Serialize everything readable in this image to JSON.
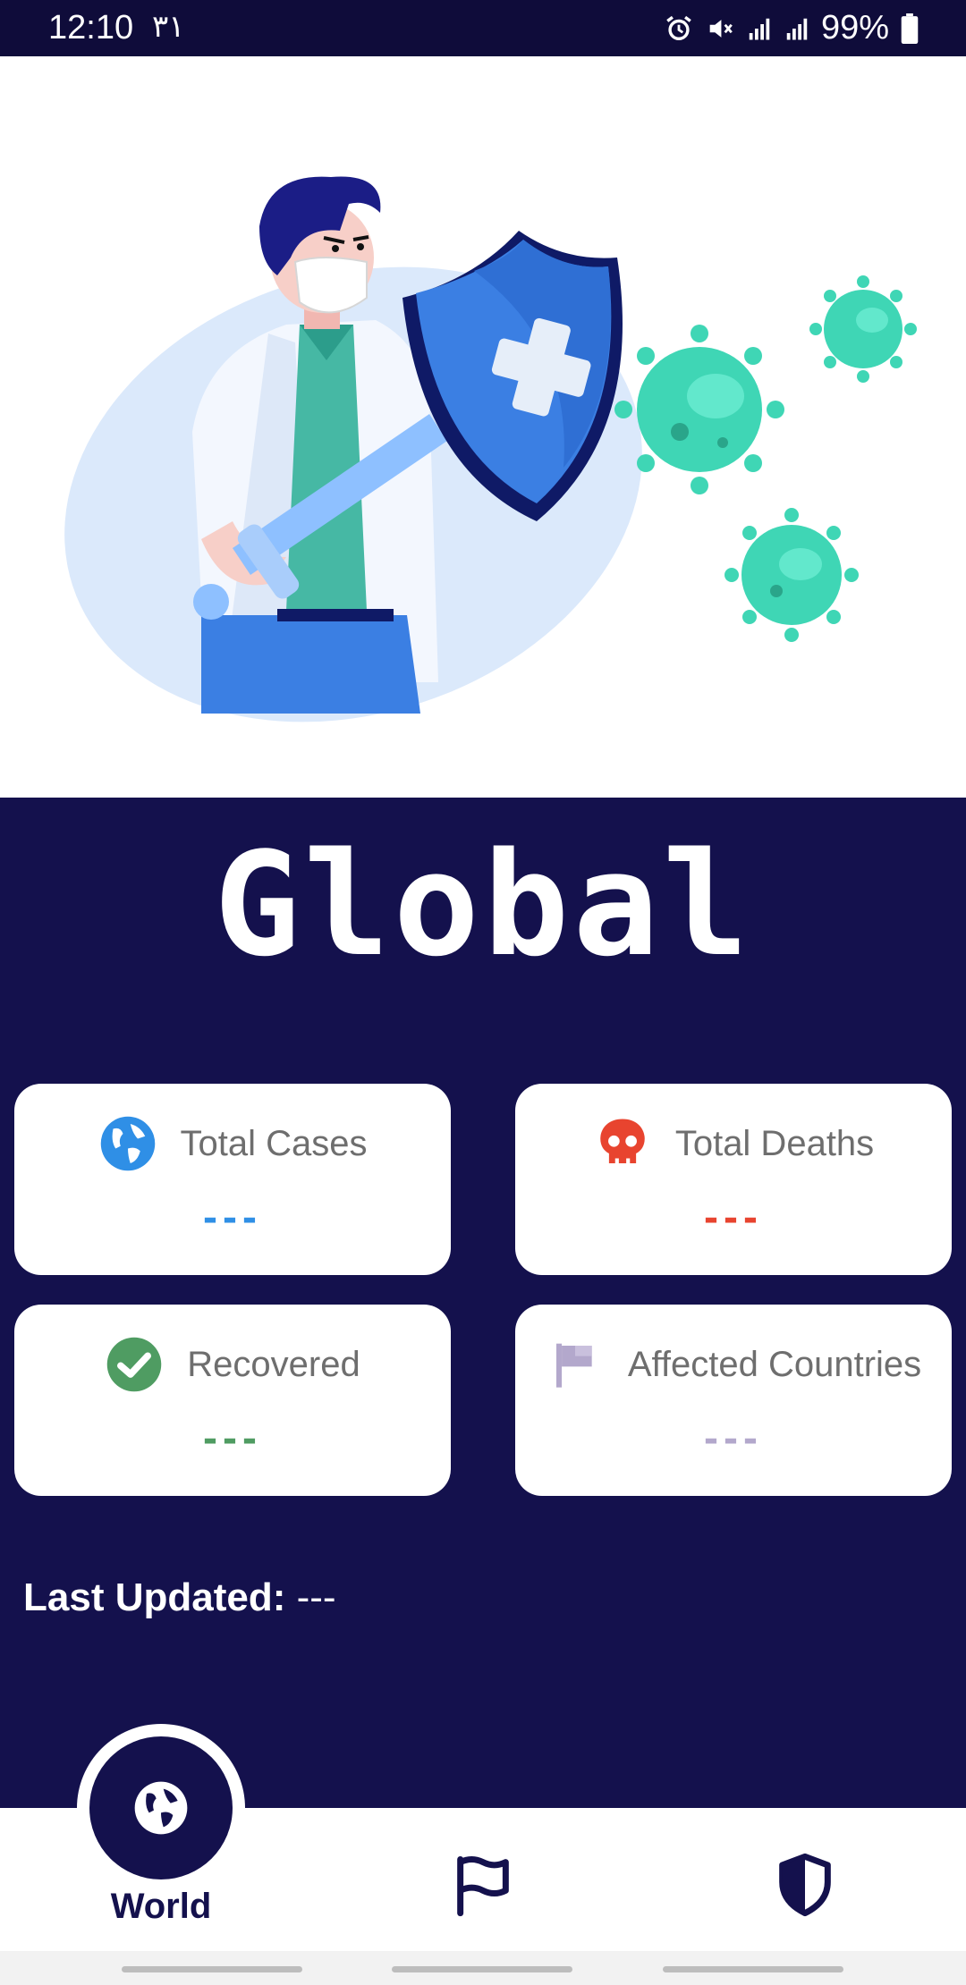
{
  "status_bar": {
    "time": "12:10",
    "extra": "٣١",
    "battery": "99%"
  },
  "main": {
    "title": "Global",
    "cards": [
      {
        "label": "Total Cases",
        "value": "---",
        "icon": "globe-icon",
        "color": "#2f8fe6"
      },
      {
        "label": "Total Deaths",
        "value": "---",
        "icon": "skull-icon",
        "color": "#e8442f"
      },
      {
        "label": "Recovered",
        "value": "---",
        "icon": "check-circle-icon",
        "color": "#4f9c62"
      },
      {
        "label": "Affected Countries",
        "value": "---",
        "icon": "flag-icon",
        "color": "#b3a8cc"
      }
    ],
    "last_updated_label": "Last Updated:",
    "last_updated_value": "---"
  },
  "bottom_nav": {
    "items": [
      {
        "label": "World",
        "icon": "globe-icon",
        "active": true
      },
      {
        "label": "",
        "icon": "flag-icon",
        "active": false
      },
      {
        "label": "",
        "icon": "shield-icon",
        "active": false
      }
    ]
  },
  "colors": {
    "primary": "#14114d",
    "status_bar": "#0f0c3a",
    "virus": "#3fd6b5",
    "shield": "#3b7fe3"
  }
}
